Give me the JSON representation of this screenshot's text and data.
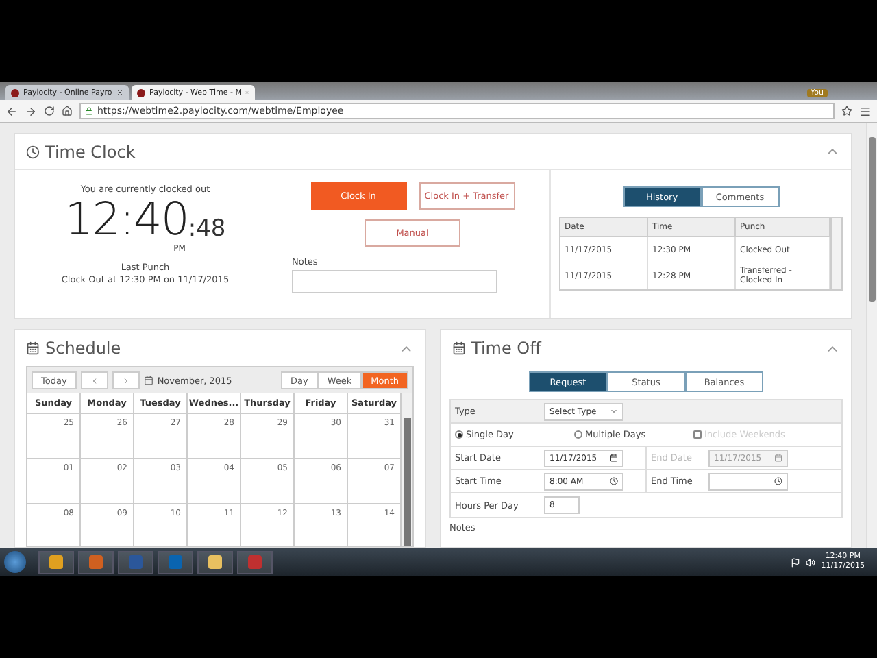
{
  "browser": {
    "tabs": [
      {
        "label": "Paylocity - Online Payro",
        "selected": false
      },
      {
        "label": "Paylocity - Web Time - M",
        "selected": true
      }
    ],
    "user_badge": "You",
    "url": "https://webtime2.paylocity.com/webtime/Employee"
  },
  "time_clock": {
    "title": "Time Clock",
    "status": "You are currently clocked out",
    "time": "12:40",
    "seconds": ":48",
    "ampm": "PM",
    "last_punch_label": "Last Punch",
    "last_punch": "Clock Out at 12:30 PM on 11/17/2015",
    "buttons": [
      {
        "label": "Clock In",
        "kind": "primary"
      },
      {
        "label": "Clock In + Transfer",
        "kind": "outline"
      },
      {
        "label": "Manual",
        "kind": "outline"
      }
    ],
    "notes_label": "Notes",
    "history_tabs": [
      {
        "label": "History",
        "selected": true
      },
      {
        "label": "Comments",
        "selected": false
      }
    ],
    "history": {
      "columns": [
        "Date",
        "Time",
        "Punch"
      ],
      "rows": [
        [
          "11/17/2015",
          "12:30 PM",
          "Clocked Out"
        ],
        [
          "11/17/2015",
          "12:28 PM",
          "Transferred - Clocked In"
        ]
      ]
    }
  },
  "schedule": {
    "title": "Schedule",
    "today": "Today",
    "month": "November, 2015",
    "views": [
      {
        "label": "Day",
        "selected": false
      },
      {
        "label": "Week",
        "selected": false
      },
      {
        "label": "Month",
        "selected": true
      }
    ],
    "weekdays": [
      "Sunday",
      "Monday",
      "Tuesday",
      "Wednes...",
      "Thursday",
      "Friday",
      "Saturday"
    ],
    "weeks": [
      [
        "25",
        "26",
        "27",
        "28",
        "29",
        "30",
        "31"
      ],
      [
        "01",
        "02",
        "03",
        "04",
        "05",
        "06",
        "07"
      ],
      [
        "08",
        "09",
        "10",
        "11",
        "12",
        "13",
        "14"
      ]
    ]
  },
  "time_off": {
    "title": "Time Off",
    "tabs": [
      {
        "label": "Request",
        "selected": true
      },
      {
        "label": "Status",
        "selected": false
      },
      {
        "label": "Balances",
        "selected": false
      }
    ],
    "type_label": "Type",
    "type_value": "Select Type",
    "day_options": [
      {
        "kind": "radio",
        "label": "Single Day",
        "selected": true,
        "disabled": false
      },
      {
        "kind": "radio",
        "label": "Multiple Days",
        "selected": false,
        "disabled": false
      },
      {
        "kind": "checkbox",
        "label": "Include Weekends",
        "selected": false,
        "disabled": true
      }
    ],
    "start_date_label": "Start Date",
    "start_date": "11/17/2015",
    "end_date_label": "End Date",
    "end_date": "11/17/2015",
    "end_date_disabled": true,
    "start_time_label": "Start Time",
    "start_time": "8:00 AM",
    "end_time_label": "End Time",
    "hours_label": "Hours Per Day",
    "hours": "8",
    "notes_label": "Notes"
  },
  "taskbar": {
    "time": "12:40 PM",
    "date": "11/17/2015"
  }
}
